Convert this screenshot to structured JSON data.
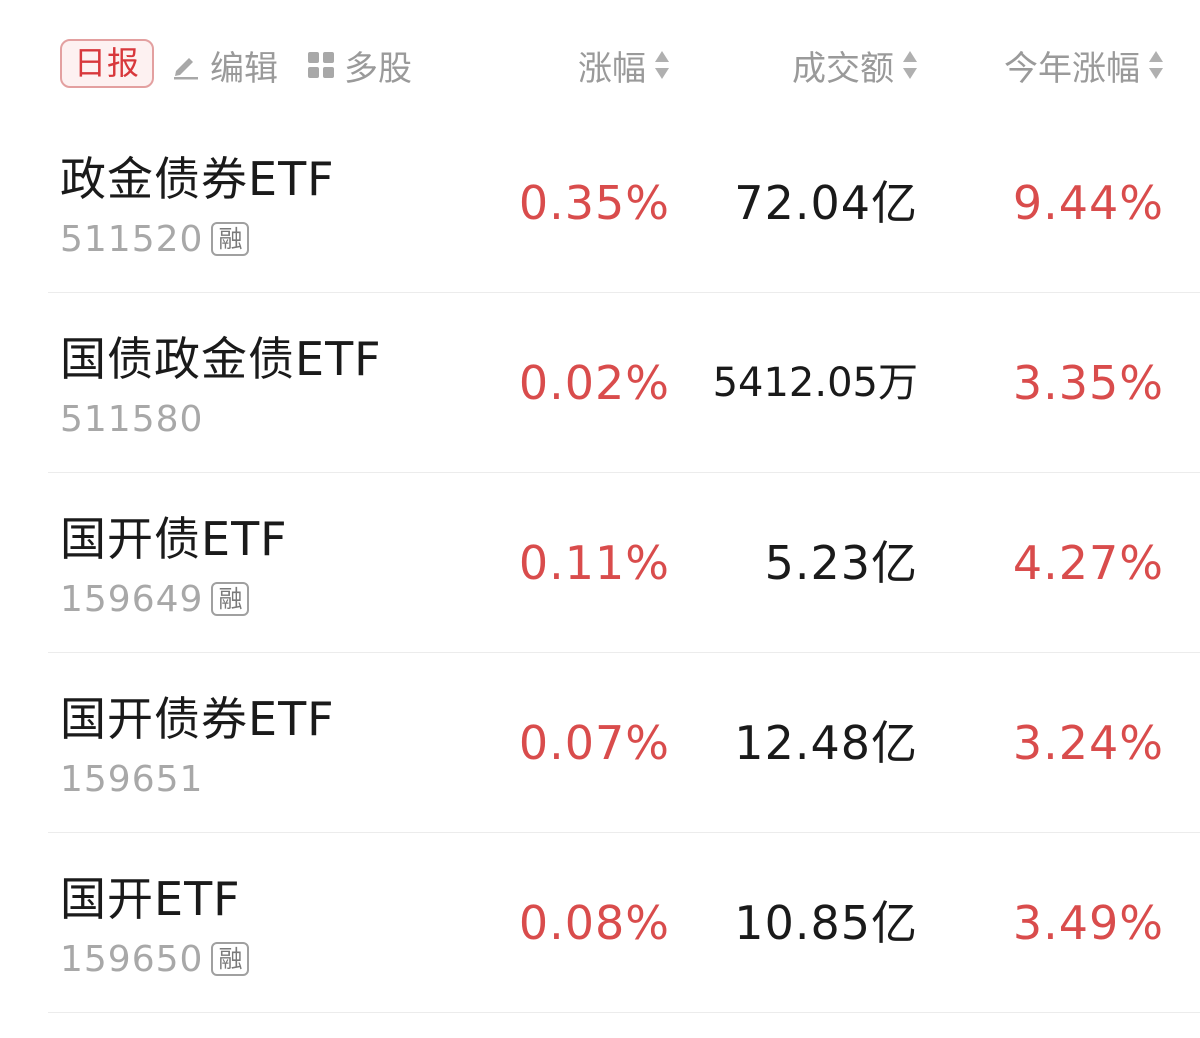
{
  "header": {
    "period_label": "日报",
    "edit_label": "编辑",
    "multi_label": "多股",
    "columns": {
      "change": "涨幅",
      "volume": "成交额",
      "ytd": "今年涨幅"
    }
  },
  "colors": {
    "up": "#d94c4c",
    "text": "#1a1a1a",
    "muted": "#9a9a9a"
  },
  "rows": [
    {
      "name": "政金债券ETF",
      "code": "511520",
      "badge": "融",
      "change": "0.35%",
      "volume": "72.04亿",
      "ytd": "9.44%"
    },
    {
      "name": "国债政金债ETF",
      "code": "511580",
      "badge": "",
      "change": "0.02%",
      "volume": "5412.05万",
      "ytd": "3.35%"
    },
    {
      "name": "国开债ETF",
      "code": "159649",
      "badge": "融",
      "change": "0.11%",
      "volume": "5.23亿",
      "ytd": "4.27%"
    },
    {
      "name": "国开债券ETF",
      "code": "159651",
      "badge": "",
      "change": "0.07%",
      "volume": "12.48亿",
      "ytd": "3.24%"
    },
    {
      "name": "国开ETF",
      "code": "159650",
      "badge": "融",
      "change": "0.08%",
      "volume": "10.85亿",
      "ytd": "3.49%"
    }
  ]
}
